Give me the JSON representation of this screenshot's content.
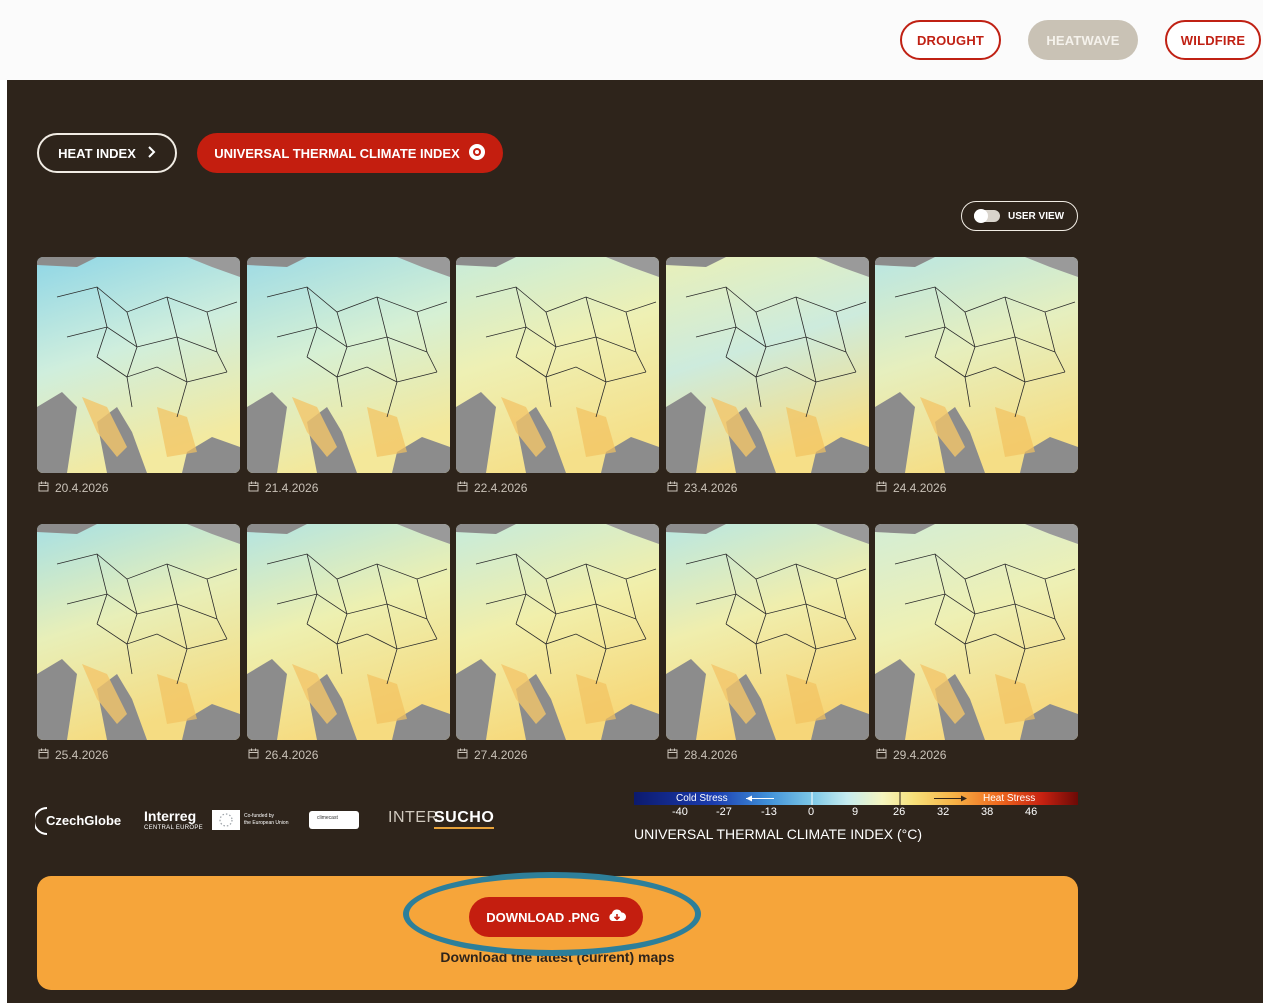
{
  "colors": {
    "accent_red": "#c41e0f",
    "panel_dark": "#2e241b",
    "download_panel": "#f6a53a",
    "highlight_ring": "#2d7f9a"
  },
  "nav": {
    "tabs": [
      {
        "label": "DROUGHT",
        "active": false
      },
      {
        "label": "HEATWAVE",
        "active": true
      },
      {
        "label": "WILDFIRE",
        "active": false
      }
    ]
  },
  "index_buttons": {
    "heat_index": {
      "label": "HEAT INDEX",
      "icon": "chevron-right-icon"
    },
    "utci": {
      "label": "UNIVERSAL THERMAL CLIMATE INDEX",
      "icon": "eye-icon"
    }
  },
  "user_view": {
    "label": "USER VIEW",
    "enabled": false
  },
  "maps": [
    {
      "date": "20.4.2026"
    },
    {
      "date": "21.4.2026"
    },
    {
      "date": "22.4.2026"
    },
    {
      "date": "23.4.2026"
    },
    {
      "date": "24.4.2026"
    },
    {
      "date": "25.4.2026"
    },
    {
      "date": "26.4.2026"
    },
    {
      "date": "27.4.2026"
    },
    {
      "date": "28.4.2026"
    },
    {
      "date": "29.4.2026"
    }
  ],
  "logos": {
    "czechglobe": "CzechGlobe",
    "interreg": "Interreg",
    "interreg_sub": "CENTRAL EUROPE",
    "eu_text_1": "Co-funded by",
    "eu_text_2": "the European Union",
    "clim_badge": "climecast",
    "intersucho_a": "INTER",
    "intersucho_b": "SUCHO"
  },
  "legend": {
    "cold_label": "Cold Stress",
    "heat_label": "Heat Stress",
    "ticks": [
      "-40",
      "-27",
      "-13",
      "0",
      "9",
      "26",
      "32",
      "38",
      "46"
    ],
    "title": "UNIVERSAL THERMAL CLIMATE INDEX (°C)"
  },
  "download": {
    "button_label": "DOWNLOAD .PNG",
    "icon": "cloud-download-icon",
    "hint": "Download the latest (current) maps"
  }
}
